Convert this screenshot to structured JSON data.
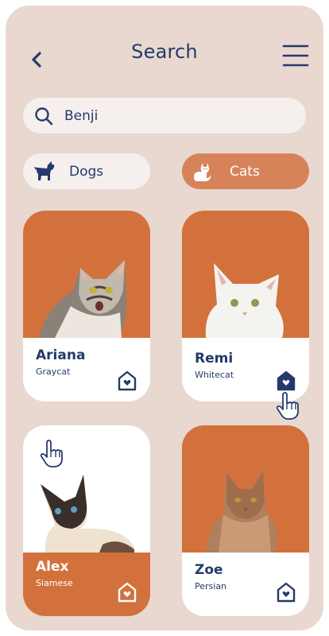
{
  "header": {
    "title": "Search"
  },
  "search": {
    "value": "Benji"
  },
  "categories": [
    {
      "label": "Dogs",
      "selected": false
    },
    {
      "label": "Cats",
      "selected": true
    }
  ],
  "pets": [
    {
      "name": "Ariana",
      "breed": "Graycat"
    },
    {
      "name": "Remi",
      "breed": "Whitecat"
    },
    {
      "name": "Alex",
      "breed": "Siamese"
    },
    {
      "name": "Zoe",
      "breed": "Persian"
    }
  ],
  "colors": {
    "background": "#e8d8d0",
    "accent": "#d3713d",
    "accent_light": "#d7835a",
    "navy": "#253a6b"
  },
  "icons": [
    "chevron-left-icon",
    "hamburger-menu-icon",
    "search-icon",
    "dog-icon",
    "cat-icon",
    "heart-home-icon",
    "pointer-hand-icon"
  ]
}
